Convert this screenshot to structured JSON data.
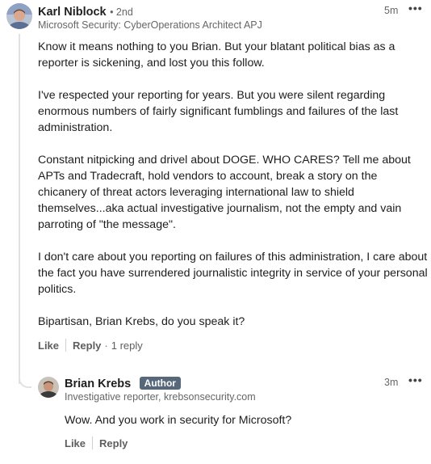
{
  "comment": {
    "author": "Karl Niblock",
    "degree": "• 2nd",
    "headline": "Microsoft Security: CyberOperations Architect APJ",
    "time": "5m",
    "more_icon": "more-horizontal-icon",
    "paragraphs": [
      "Know it means nothing to you Brian. But your blatant political bias as a reporter is sickening, and lost you this follow.",
      "I've respected your reporting for years. But you were silent regarding enormous numbers of fairly significant fumblings and failures of the last administration.",
      "Constant nitpicking and drivel about DOGE. WHO CARES? Tell me about APTs and Tradecraft, hold vendors to account, break a story on the chicanery of threat actors leveraging international law to shield themselves...aka actual investigative journalism, not the empty and vain parroting of \"the message\".",
      "I don't care about you reporting on failures of this administration, I care about the fact you have surrendered journalistic integrity in service of your personal politics.",
      "Bipartisan, Brian Krebs, do you speak it?"
    ],
    "like_label": "Like",
    "reply_label": "Reply",
    "reply_count": "1 reply"
  },
  "reply": {
    "author": "Brian Krebs",
    "badge": "Author",
    "headline": "Investigative reporter, krebsonsecurity.com",
    "time": "3m",
    "text": "Wow. And you work in security for Microsoft?",
    "like_label": "Like",
    "reply_label": "Reply"
  },
  "colors": {
    "badge_bg": "#56687a",
    "thread_line": "#e2e2e2"
  }
}
